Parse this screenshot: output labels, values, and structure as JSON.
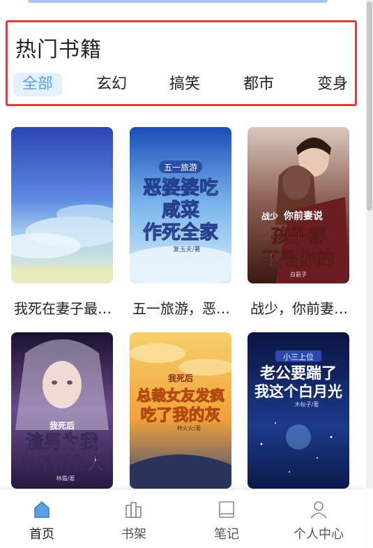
{
  "section": {
    "title": "热门书籍",
    "tabs": [
      {
        "label": "全部",
        "active": true
      },
      {
        "label": "玄幻",
        "active": false
      },
      {
        "label": "搞笑",
        "active": false
      },
      {
        "label": "都市",
        "active": false
      },
      {
        "label": "变身",
        "active": false
      }
    ]
  },
  "books": [
    {
      "title": "我死在妻子最…",
      "cover_text": []
    },
    {
      "title": "五一旅游，恶…",
      "cover_text": [
        "五一旅游",
        "恶婆婆吃",
        "咸菜",
        "作死全家",
        "复玉夫/著"
      ]
    },
    {
      "title": "战少，你前妻…",
      "cover_text": [
        "战少",
        "你前妻说",
        "孩子都",
        "不是你的",
        "白箭子"
      ]
    },
    {
      "title": "",
      "cover_text": [
        "我死后",
        "渣男为我",
        "杀了所有人",
        "林霜/著"
      ]
    },
    {
      "title": "",
      "cover_text": [
        "我死后",
        "总裁女友发疯",
        "吃了我的灰",
        "林火火/著"
      ]
    },
    {
      "title": "",
      "cover_text": [
        "小三上位",
        "老公要踹了",
        "我这个白月光",
        "木标子/著"
      ]
    }
  ],
  "tabbar": {
    "items": [
      {
        "label": "首页",
        "icon": "home-icon",
        "active": true
      },
      {
        "label": "书架",
        "icon": "bookshelf-icon",
        "active": false
      },
      {
        "label": "笔记",
        "icon": "notes-icon",
        "active": false
      },
      {
        "label": "个人中心",
        "icon": "user-icon",
        "active": false
      }
    ]
  },
  "colors": {
    "accent": "#5aa0e4",
    "active_tab_bg": "#e4f0fb",
    "highlight_border": "#e23a3a"
  }
}
